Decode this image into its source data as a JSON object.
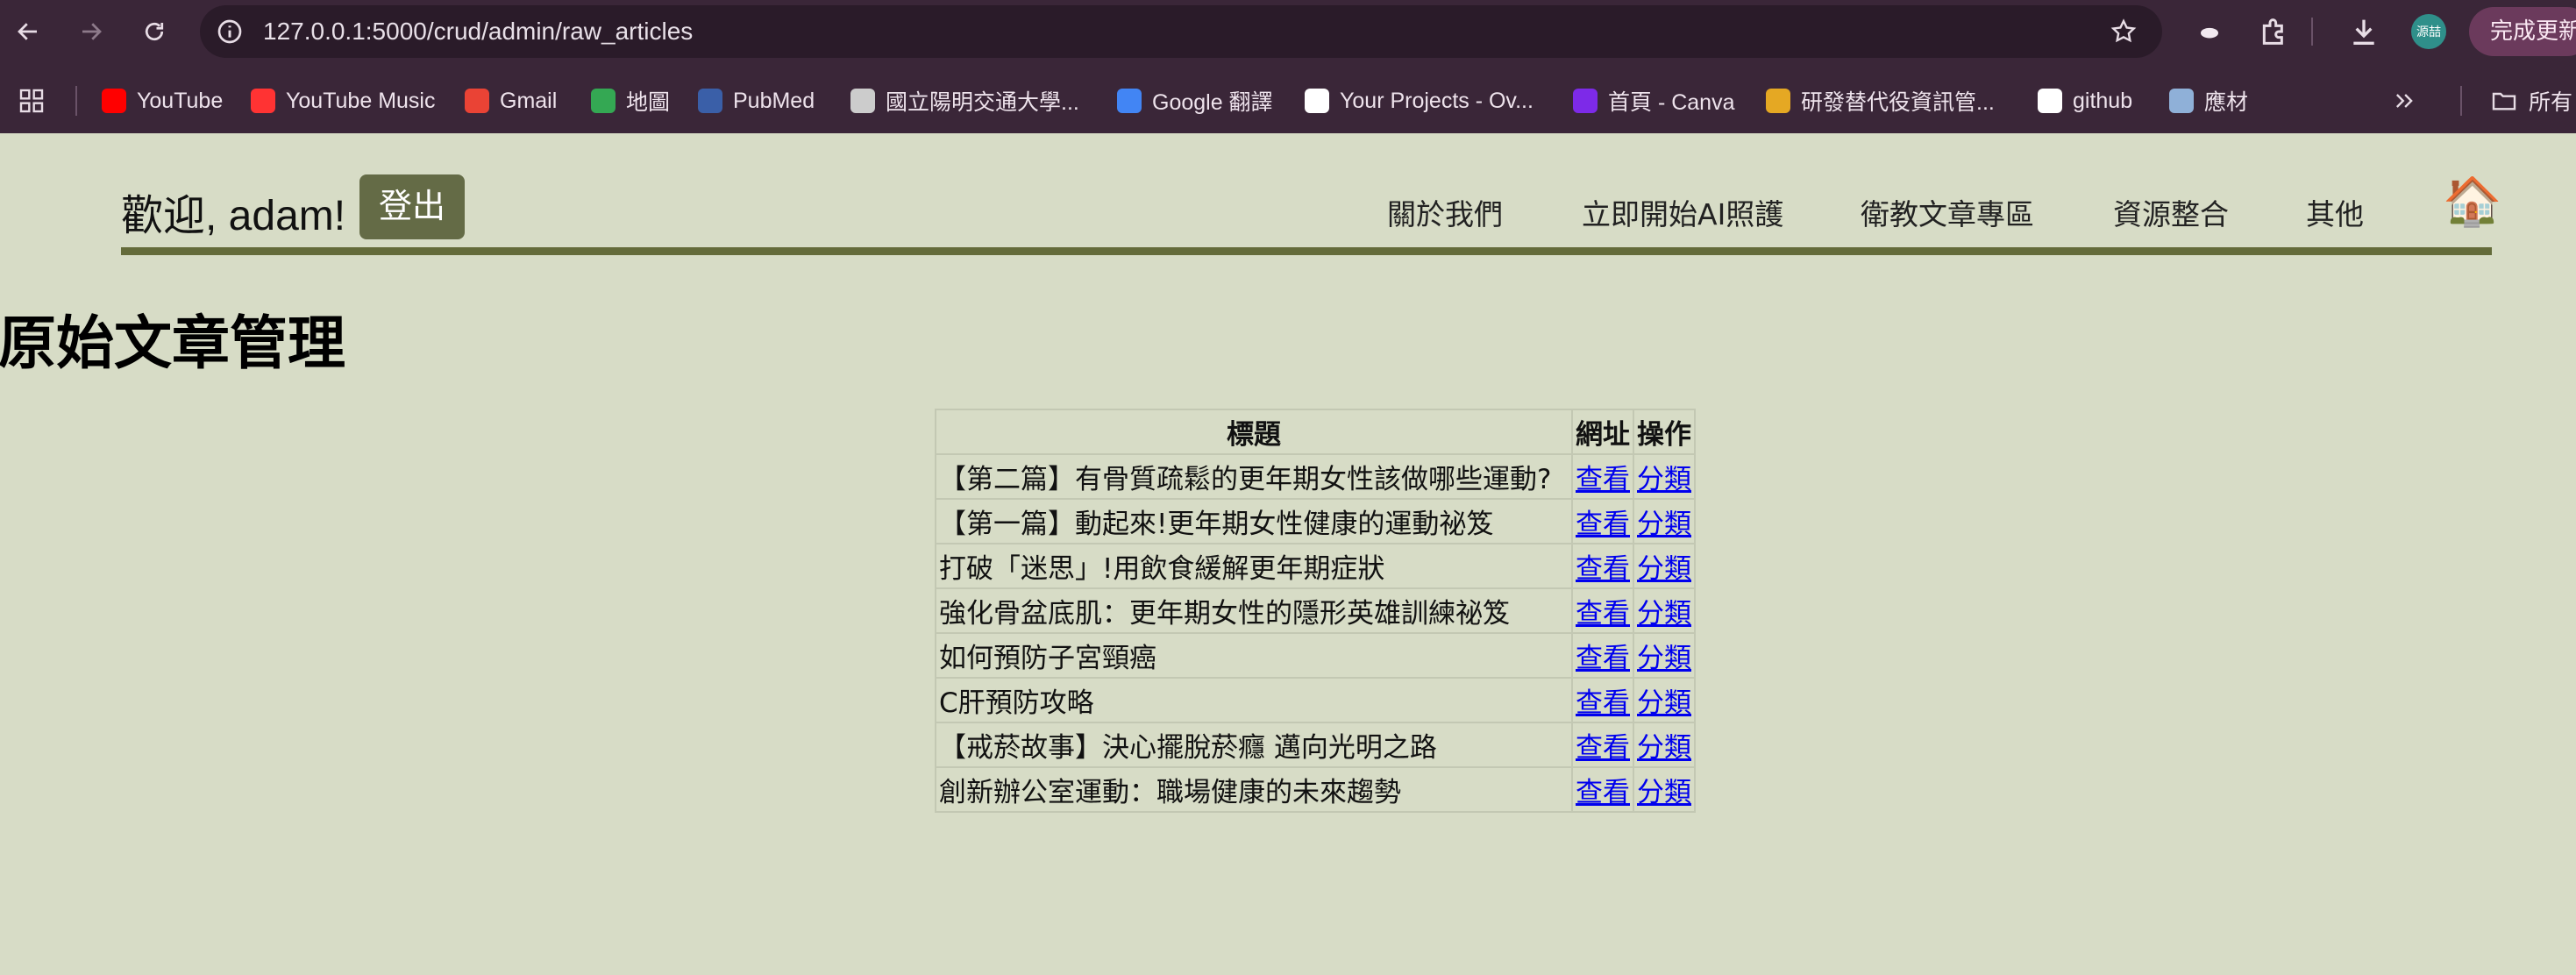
{
  "browser": {
    "url": "127.0.0.1:5000/crud/admin/raw_articles",
    "profile_label": "源喆",
    "finish_label": "完成更新",
    "all_bookmarks_label": "所有",
    "bookmarks": [
      {
        "label": "YouTube",
        "icon": "youtube-icon",
        "color": "#ff0000"
      },
      {
        "label": "YouTube Music",
        "icon": "youtube-music-icon",
        "color": "#ff3333"
      },
      {
        "label": "Gmail",
        "icon": "gmail-icon",
        "color": "#ea4335"
      },
      {
        "label": "地圖",
        "icon": "maps-icon",
        "color": "#34a853"
      },
      {
        "label": "PubMed",
        "icon": "pubmed-icon",
        "color": "#3a5fa8"
      },
      {
        "label": "國立陽明交通大學...",
        "icon": "globe-icon",
        "color": "#cccccc"
      },
      {
        "label": "Google 翻譯",
        "icon": "translate-icon",
        "color": "#4285f4"
      },
      {
        "label": "Your Projects - Ov...",
        "icon": "overleaf-icon",
        "color": "#ffffff"
      },
      {
        "label": "首頁 - Canva",
        "icon": "canva-icon",
        "color": "#7d2ae8"
      },
      {
        "label": "研發替代役資訊管...",
        "icon": "rdss-icon",
        "color": "#e5a823"
      },
      {
        "label": "github",
        "icon": "github-icon",
        "color": "#ffffff"
      },
      {
        "label": "應材",
        "icon": "amat-icon",
        "color": "#8fb0d8"
      }
    ]
  },
  "header": {
    "welcome": "歡迎, adam!",
    "logout_label": "登出",
    "menu": [
      "關於我們",
      "立即開始AI照護",
      "衛教文章專區",
      "資源整合",
      "其他"
    ],
    "home_icon": "🏠"
  },
  "page": {
    "title": "原始文章管理"
  },
  "table": {
    "headers": [
      "標題",
      "網址",
      "操作"
    ],
    "view_label": "查看",
    "classify_label": "分類",
    "rows": [
      "【第二篇】有骨質疏鬆的更年期女性該做哪些運動?",
      "【第一篇】動起來!更年期女性健康的運動祕笈",
      "打破「迷思」!用飲食緩解更年期症狀",
      "強化骨盆底肌：更年期女性的隱形英雄訓練祕笈",
      "如何預防子宮頸癌",
      "C肝預防攻略",
      "【戒菸故事】決心擺脫菸癮 邁向光明之路",
      "創新辦公室運動：職場健康的未來趨勢"
    ]
  },
  "colors": {
    "page_bg": "#d7dcc6",
    "accent": "#646b46",
    "chrome": "#3a2638",
    "link": "#0000ee"
  }
}
